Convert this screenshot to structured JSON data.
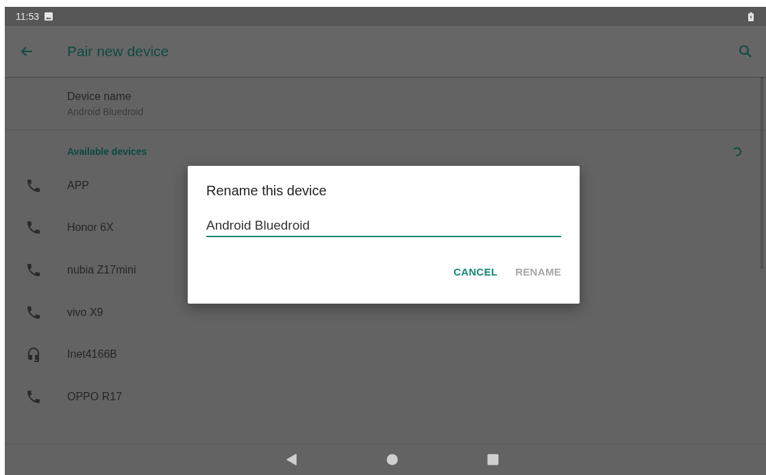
{
  "status_bar": {
    "time": "11:53"
  },
  "app_bar": {
    "title": "Pair new device"
  },
  "device_name": {
    "label": "Device name",
    "value": "Android Bluedroid"
  },
  "available": {
    "header": "Available devices"
  },
  "devices": [
    {
      "kind": "phone",
      "name": "APP"
    },
    {
      "kind": "phone",
      "name": "Honor 6X"
    },
    {
      "kind": "phone",
      "name": "nubia Z17mini"
    },
    {
      "kind": "phone",
      "name": "vivo X9"
    },
    {
      "kind": "headset",
      "name": "Inet4166B"
    },
    {
      "kind": "phone",
      "name": "OPPO R17"
    }
  ],
  "dialog": {
    "title": "Rename this device",
    "field": {
      "value": "Android Bluedroid"
    },
    "buttons": [
      {
        "label": "CANCEL",
        "disabled": false
      },
      {
        "label": "RENAME",
        "disabled": true
      }
    ]
  }
}
